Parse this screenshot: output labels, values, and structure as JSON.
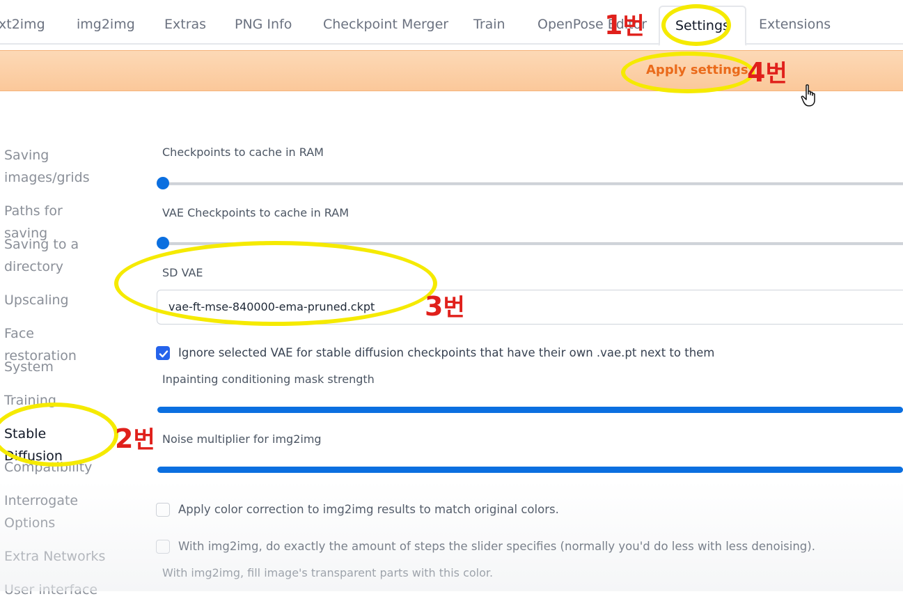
{
  "tabs": [
    {
      "label": "xt2img"
    },
    {
      "label": "img2img"
    },
    {
      "label": "Extras"
    },
    {
      "label": "PNG Info"
    },
    {
      "label": "Checkpoint Merger"
    },
    {
      "label": "Train"
    },
    {
      "label": "OpenPose Editor"
    },
    {
      "label": "Settings",
      "active": true
    },
    {
      "label": "Extensions"
    }
  ],
  "apply_button": {
    "label": "Apply settings"
  },
  "sidebar": {
    "items": [
      {
        "label": "Saving images/grids"
      },
      {
        "label": "Paths for saving"
      },
      {
        "label": "Saving to a directory"
      },
      {
        "label": "Upscaling"
      },
      {
        "label": "Face restoration"
      },
      {
        "label": "System"
      },
      {
        "label": "Training"
      },
      {
        "label": "Stable Diffusion",
        "active": true
      },
      {
        "label": "Compatibility"
      },
      {
        "label": "Interrogate Options"
      },
      {
        "label": "Extra Networks"
      },
      {
        "label": "User interface"
      }
    ]
  },
  "settings": {
    "checkpoints_cache": {
      "label": "Checkpoints to cache in RAM",
      "value": 0
    },
    "vae_checkpoints_cache": {
      "label": "VAE Checkpoints to cache in RAM",
      "value": 0
    },
    "sd_vae": {
      "label": "SD VAE",
      "value": "vae-ft-mse-840000-ema-pruned.ckpt"
    },
    "ignore_vae": {
      "label": "Ignore selected VAE for stable diffusion checkpoints that have their own .vae.pt next to them",
      "checked": true
    },
    "inpainting_mask_strength": {
      "label": "Inpainting conditioning mask strength",
      "value": 1
    },
    "noise_multiplier": {
      "label": "Noise multiplier for img2img",
      "value": 1
    },
    "color_correction": {
      "label": "Apply color correction to img2img results to match original colors.",
      "checked": false
    },
    "exact_steps": {
      "label": "With img2img, do exactly the amount of steps the slider specifies (normally you'd do less with less denoising).",
      "checked": false
    },
    "transparent_fill": {
      "label": "With img2img, fill image's transparent parts with this color."
    }
  },
  "annotations": {
    "a1": {
      "num": "1",
      "kr": "번"
    },
    "a2": {
      "num": "2",
      "kr": "번"
    },
    "a3": {
      "num": "3",
      "kr": "번"
    },
    "a4": {
      "num": "4",
      "kr": "번"
    }
  },
  "colors": {
    "accent": "#0b6fe0",
    "apply": "#ea6a1a",
    "annotation_ring": "#f5ea00",
    "annotation_text": "#e0201b"
  }
}
